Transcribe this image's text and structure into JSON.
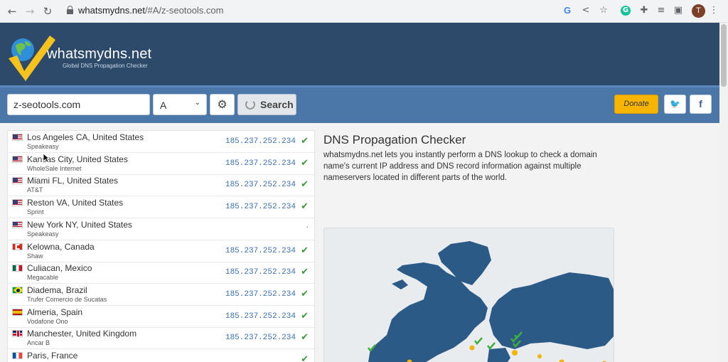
{
  "browser": {
    "url_host": "whatsmydns.net",
    "url_path": "/#A/z-seotools.com",
    "profile_initial": "T"
  },
  "site": {
    "brand": "whatsmydns.net",
    "tagline": "Global DNS Propagation Checker"
  },
  "search": {
    "domain_value": "z-seotools.com",
    "record_type": "A",
    "search_label": "Search",
    "donate_label": "Donate"
  },
  "results": [
    {
      "location": "Los Angeles CA, United States",
      "provider": "Speakeasy",
      "flag": "us",
      "ip": "185.237.252.234",
      "status": "ok"
    },
    {
      "location": "Kansas City, United States",
      "provider": "WholeSale Internet",
      "flag": "us",
      "ip": "185.237.252.234",
      "status": "ok"
    },
    {
      "location": "Miami FL, United States",
      "provider": "AT&T",
      "flag": "us",
      "ip": "185.237.252.234",
      "status": "ok"
    },
    {
      "location": "Reston VA, United States",
      "provider": "Sprint",
      "flag": "us",
      "ip": "185.237.252.234",
      "status": "ok"
    },
    {
      "location": "New York NY, United States",
      "provider": "Speakeasy",
      "flag": "us",
      "ip": "",
      "status": "pending"
    },
    {
      "location": "Kelowna, Canada",
      "provider": "Shaw",
      "flag": "ca",
      "ip": "185.237.252.234",
      "status": "ok"
    },
    {
      "location": "Culiacan, Mexico",
      "provider": "Megacable",
      "flag": "mx",
      "ip": "185.237.252.234",
      "status": "ok"
    },
    {
      "location": "Diadema, Brazil",
      "provider": "Trufer Comercio de Sucatas",
      "flag": "br",
      "ip": "185.237.252.234",
      "status": "ok"
    },
    {
      "location": "Almeria, Spain",
      "provider": "Vodafone Ono",
      "flag": "es",
      "ip": "185.237.252.234",
      "status": "ok"
    },
    {
      "location": "Manchester, United Kingdom",
      "provider": "Ancar B",
      "flag": "uk",
      "ip": "185.237.252.234",
      "status": "ok"
    },
    {
      "location": "Paris, France",
      "provider": "",
      "flag": "fr",
      "ip": "",
      "status": "ok"
    }
  ],
  "panel": {
    "title": "DNS Propagation Checker",
    "description": "whatsmydns.net lets you instantly perform a DNS lookup to check a domain name's current IP address and DNS record information against multiple nameservers located in different parts of the world."
  },
  "colors": {
    "header_bg": "#2e4a6b",
    "search_band": "#4a76a8",
    "donate": "#f7b500",
    "ok_check": "#3a9a3a",
    "map_land": "#2c5a86"
  }
}
